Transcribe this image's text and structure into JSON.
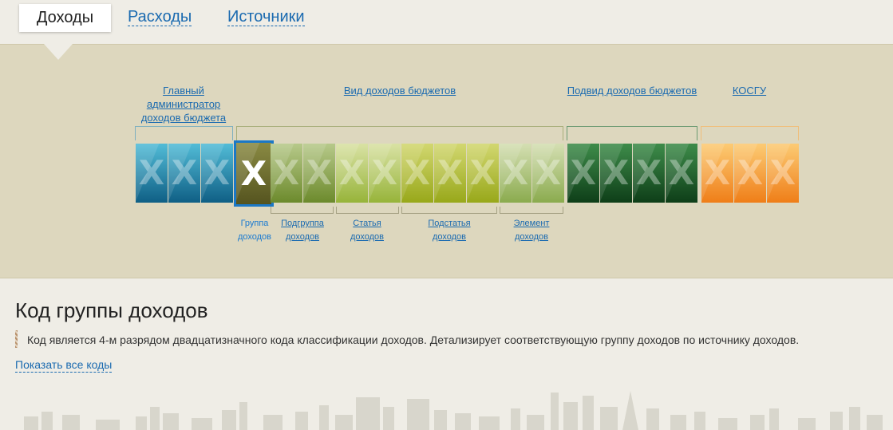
{
  "tabs": {
    "active": "Доходы",
    "expenses": "Расходы",
    "sources": "Источники"
  },
  "groups": {
    "admin": "Главный администратор доходов бюджета",
    "type": "Вид доходов бюджетов",
    "subtype": "Подвид доходов бюджетов",
    "kosgu": "КОСГУ"
  },
  "subgroups": {
    "group": "Группа доходов",
    "subgroup": "Подгруппа доходов",
    "article": "Статья доходов",
    "subarticle": "Подстатья доходов",
    "element": "Элемент доходов"
  },
  "code_glyph": "X",
  "selected_cell": 4,
  "colors": {
    "admin": "#2a8aaf",
    "group": "#6d6a2e",
    "type": "#a7b73c",
    "subtype": "#1f6b2c",
    "kosgu": "#f1962e",
    "accent": "#1a6ab0"
  },
  "content": {
    "title": "Код группы доходов",
    "description": "Код является 4-м разрядом двадцатизначного кода классификации доходов. Детализирует соответствующую группу доходов по источнику доходов.",
    "show_all": "Показать все коды"
  }
}
